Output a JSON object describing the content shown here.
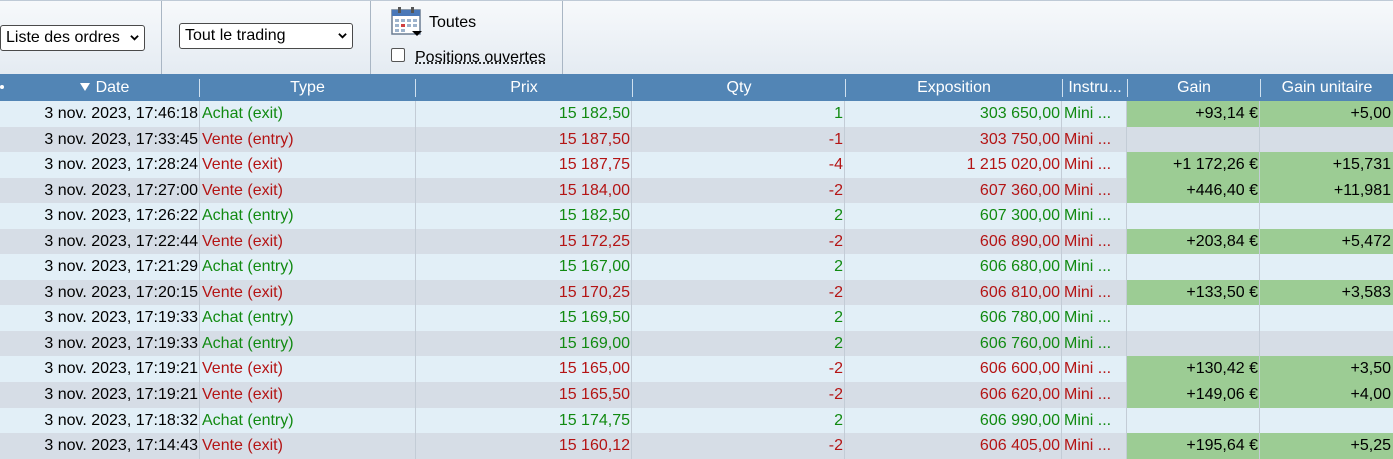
{
  "toolbar": {
    "order_list_select": "Liste des ordres",
    "trading_select": "Tout le trading",
    "period_label": "Toutes",
    "open_positions_label": "Positions ouvertes",
    "open_positions_checked": false
  },
  "columns": {
    "date": "Date",
    "type": "Type",
    "prix": "Prix",
    "qty": "Qty",
    "exposition": "Exposition",
    "instrument": "Instru...",
    "gain": "Gain",
    "gain_unitaire": "Gain unitaire"
  },
  "colors": {
    "header_bg": "#5285b5",
    "buy": "#118a11",
    "sell": "#b41414",
    "gain_bg": "#9ccc94",
    "row_odd": "#e2eff7",
    "row_even": "#d6dde6"
  },
  "rows": [
    {
      "date": "3 nov. 2023, 17:46:18",
      "type": "Achat (exit)",
      "side": "buy",
      "prix": "15 182,50",
      "qty": "1",
      "exposition": "303 650,00",
      "instrument": "Mini ...",
      "gain": "+93,14 €",
      "gain_unitaire": "+5,00"
    },
    {
      "date": "3 nov. 2023, 17:33:45",
      "type": "Vente (entry)",
      "side": "sell",
      "prix": "15 187,50",
      "qty": "-1",
      "exposition": "303 750,00",
      "instrument": "Mini ...",
      "gain": "",
      "gain_unitaire": ""
    },
    {
      "date": "3 nov. 2023, 17:28:24",
      "type": "Vente (exit)",
      "side": "sell",
      "prix": "15 187,75",
      "qty": "-4",
      "exposition": "1 215 020,00",
      "instrument": "Mini ...",
      "gain": "+1 172,26 €",
      "gain_unitaire": "+15,731"
    },
    {
      "date": "3 nov. 2023, 17:27:00",
      "type": "Vente (exit)",
      "side": "sell",
      "prix": "15 184,00",
      "qty": "-2",
      "exposition": "607 360,00",
      "instrument": "Mini ...",
      "gain": "+446,40 €",
      "gain_unitaire": "+11,981"
    },
    {
      "date": "3 nov. 2023, 17:26:22",
      "type": "Achat (entry)",
      "side": "buy",
      "prix": "15 182,50",
      "qty": "2",
      "exposition": "607 300,00",
      "instrument": "Mini ...",
      "gain": "",
      "gain_unitaire": ""
    },
    {
      "date": "3 nov. 2023, 17:22:44",
      "type": "Vente (exit)",
      "side": "sell",
      "prix": "15 172,25",
      "qty": "-2",
      "exposition": "606 890,00",
      "instrument": "Mini ...",
      "gain": "+203,84 €",
      "gain_unitaire": "+5,472"
    },
    {
      "date": "3 nov. 2023, 17:21:29",
      "type": "Achat (entry)",
      "side": "buy",
      "prix": "15 167,00",
      "qty": "2",
      "exposition": "606 680,00",
      "instrument": "Mini ...",
      "gain": "",
      "gain_unitaire": ""
    },
    {
      "date": "3 nov. 2023, 17:20:15",
      "type": "Vente (exit)",
      "side": "sell",
      "prix": "15 170,25",
      "qty": "-2",
      "exposition": "606 810,00",
      "instrument": "Mini ...",
      "gain": "+133,50 €",
      "gain_unitaire": "+3,583"
    },
    {
      "date": "3 nov. 2023, 17:19:33",
      "type": "Achat (entry)",
      "side": "buy",
      "prix": "15 169,50",
      "qty": "2",
      "exposition": "606 780,00",
      "instrument": "Mini ...",
      "gain": "",
      "gain_unitaire": ""
    },
    {
      "date": "3 nov. 2023, 17:19:33",
      "type": "Achat (entry)",
      "side": "buy",
      "prix": "15 169,00",
      "qty": "2",
      "exposition": "606 760,00",
      "instrument": "Mini ...",
      "gain": "",
      "gain_unitaire": ""
    },
    {
      "date": "3 nov. 2023, 17:19:21",
      "type": "Vente (exit)",
      "side": "sell",
      "prix": "15 165,00",
      "qty": "-2",
      "exposition": "606 600,00",
      "instrument": "Mini ...",
      "gain": "+130,42 €",
      "gain_unitaire": "+3,50"
    },
    {
      "date": "3 nov. 2023, 17:19:21",
      "type": "Vente (exit)",
      "side": "sell",
      "prix": "15 165,50",
      "qty": "-2",
      "exposition": "606 620,00",
      "instrument": "Mini ...",
      "gain": "+149,06 €",
      "gain_unitaire": "+4,00"
    },
    {
      "date": "3 nov. 2023, 17:18:32",
      "type": "Achat (entry)",
      "side": "buy",
      "prix": "15 174,75",
      "qty": "2",
      "exposition": "606 990,00",
      "instrument": "Mini ...",
      "gain": "",
      "gain_unitaire": ""
    },
    {
      "date": "3 nov. 2023, 17:14:43",
      "type": "Vente (exit)",
      "side": "sell",
      "prix": "15 160,12",
      "qty": "-2",
      "exposition": "606 405,00",
      "instrument": "Mini ...",
      "gain": "+195,64 €",
      "gain_unitaire": "+5,25"
    }
  ]
}
